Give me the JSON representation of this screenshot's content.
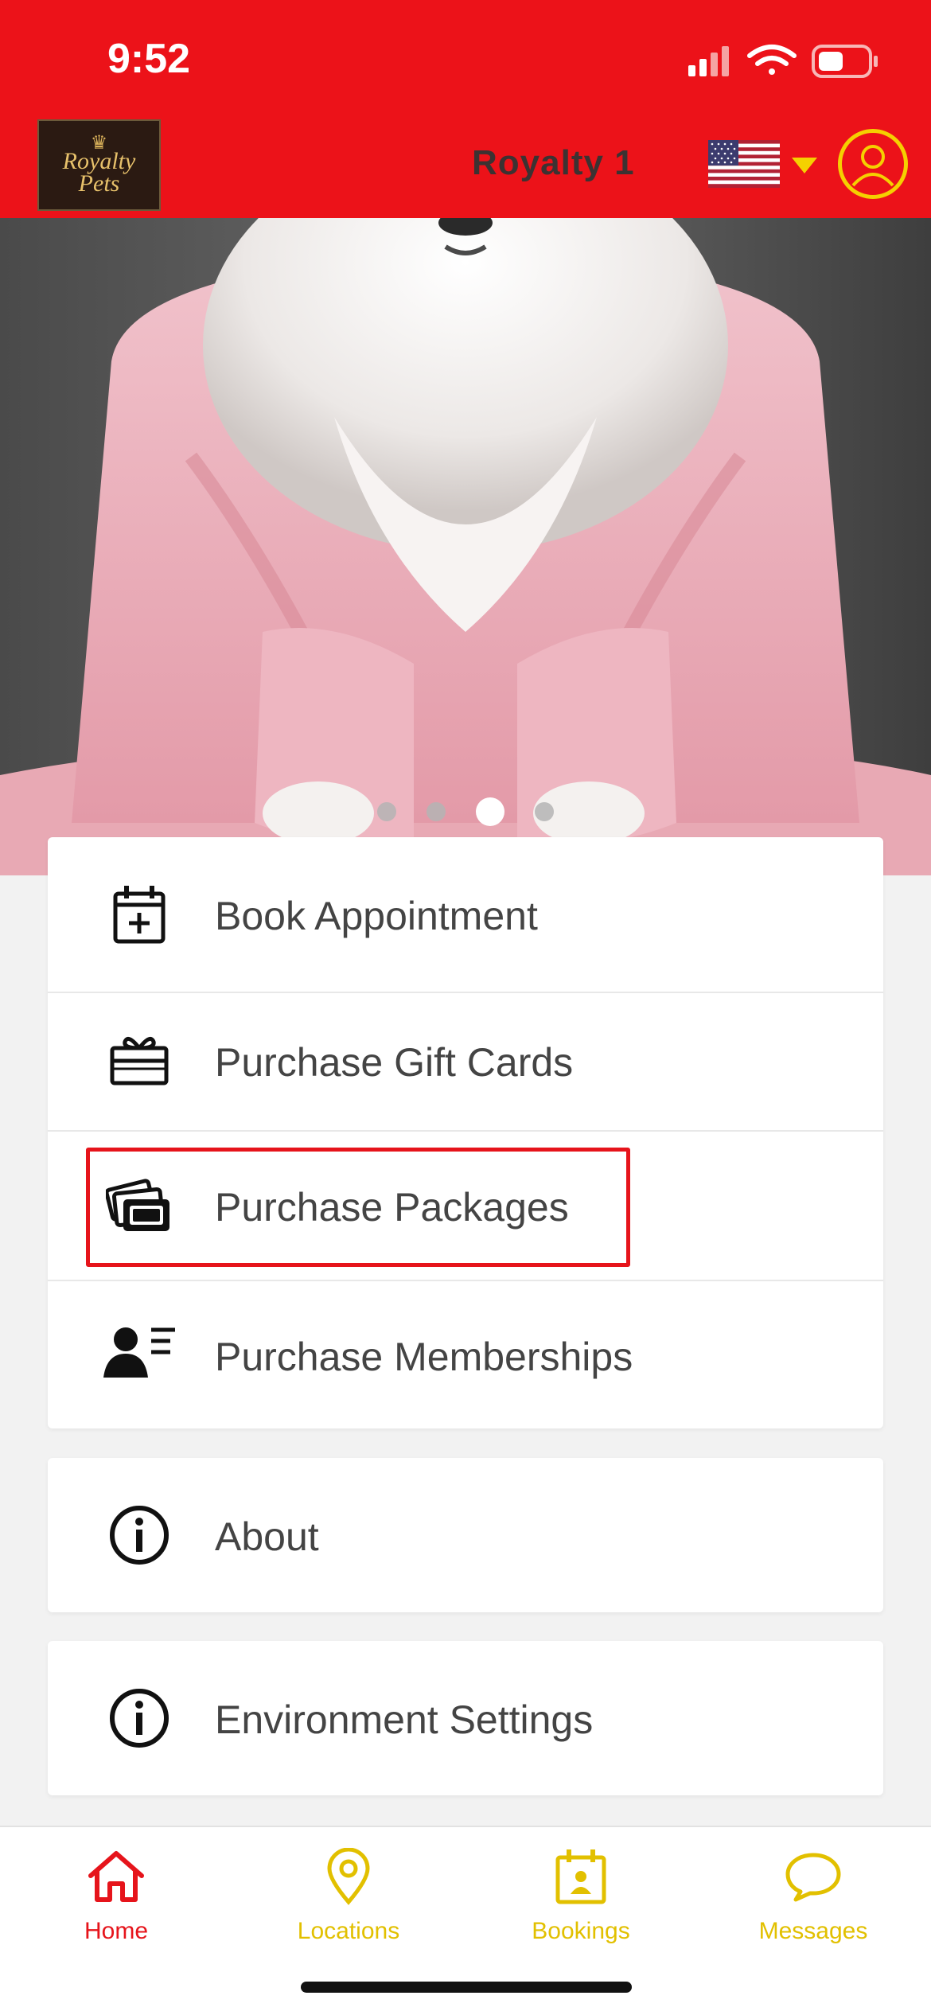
{
  "status_bar": {
    "time": "9:52"
  },
  "header": {
    "logo_line1": "Royalty",
    "logo_line2": "Pets",
    "store_name": "Royalty 1",
    "language_flag": "us-flag-icon",
    "brand_color": "#ec1219",
    "accent_color": "#f5d000"
  },
  "hero": {
    "image": "pomeranian-in-pink-robe",
    "carousel_total": 4,
    "carousel_active": 3
  },
  "menu": {
    "items": [
      {
        "label": "Book Appointment",
        "icon": "calendar-plus-icon"
      },
      {
        "label": "Purchase Gift Cards",
        "icon": "gift-card-icon"
      },
      {
        "label": "Purchase Packages",
        "icon": "packages-icon",
        "highlighted": true
      },
      {
        "label": "Purchase Memberships",
        "icon": "membership-icon"
      }
    ],
    "about": {
      "label": "About",
      "icon": "info-icon"
    },
    "environment": {
      "label": "Environment Settings",
      "icon": "info-icon"
    }
  },
  "tabs": [
    {
      "label": "Home",
      "icon": "home-icon",
      "active": true,
      "color": "#e6141b"
    },
    {
      "label": "Locations",
      "icon": "location-pin-icon",
      "active": false,
      "color": "#e2c000"
    },
    {
      "label": "Bookings",
      "icon": "bookings-calendar-icon",
      "active": false,
      "color": "#e2c000"
    },
    {
      "label": "Messages",
      "icon": "chat-bubble-icon",
      "active": false,
      "color": "#e2c000"
    }
  ]
}
